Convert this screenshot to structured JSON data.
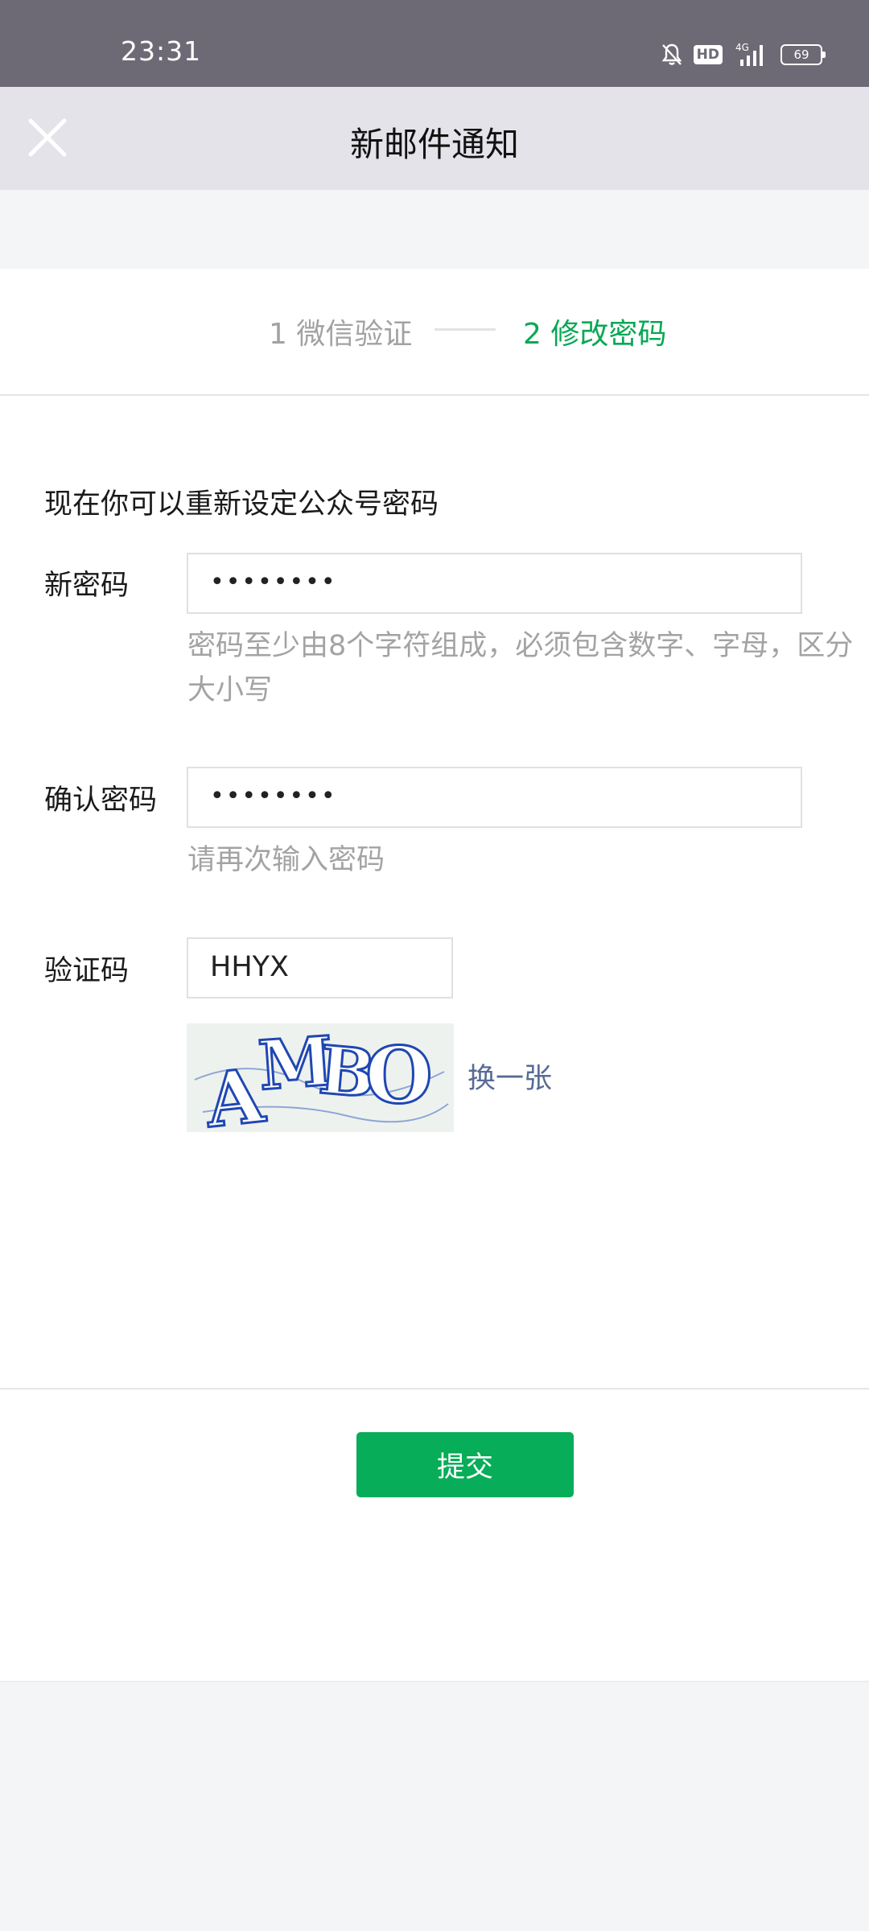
{
  "status_bar": {
    "time": "23:31",
    "hd": "HD",
    "network": "4G",
    "battery": "69"
  },
  "header": {
    "title": "新邮件通知"
  },
  "steps": [
    {
      "label": "1 微信验证",
      "active": false
    },
    {
      "label": "2 修改密码",
      "active": true
    }
  ],
  "form": {
    "intro": "现在你可以重新设定公众号密码",
    "new_password": {
      "label": "新密码",
      "value": "••••••••",
      "hint": "密码至少由8个字符组成，必须包含数字、字母，区分大小写"
    },
    "confirm_password": {
      "label": "确认密码",
      "value": "••••••••",
      "hint": "请再次输入密码"
    },
    "captcha": {
      "label": "验证码",
      "value": "HHYX",
      "image_text": "AMBO",
      "refresh_label": "换一张"
    }
  },
  "submit_label": "提交",
  "colors": {
    "accent": "#07ad58",
    "link": "#576b95",
    "status_bar": "#6d6a75",
    "header_bg": "#e4e3e9"
  }
}
